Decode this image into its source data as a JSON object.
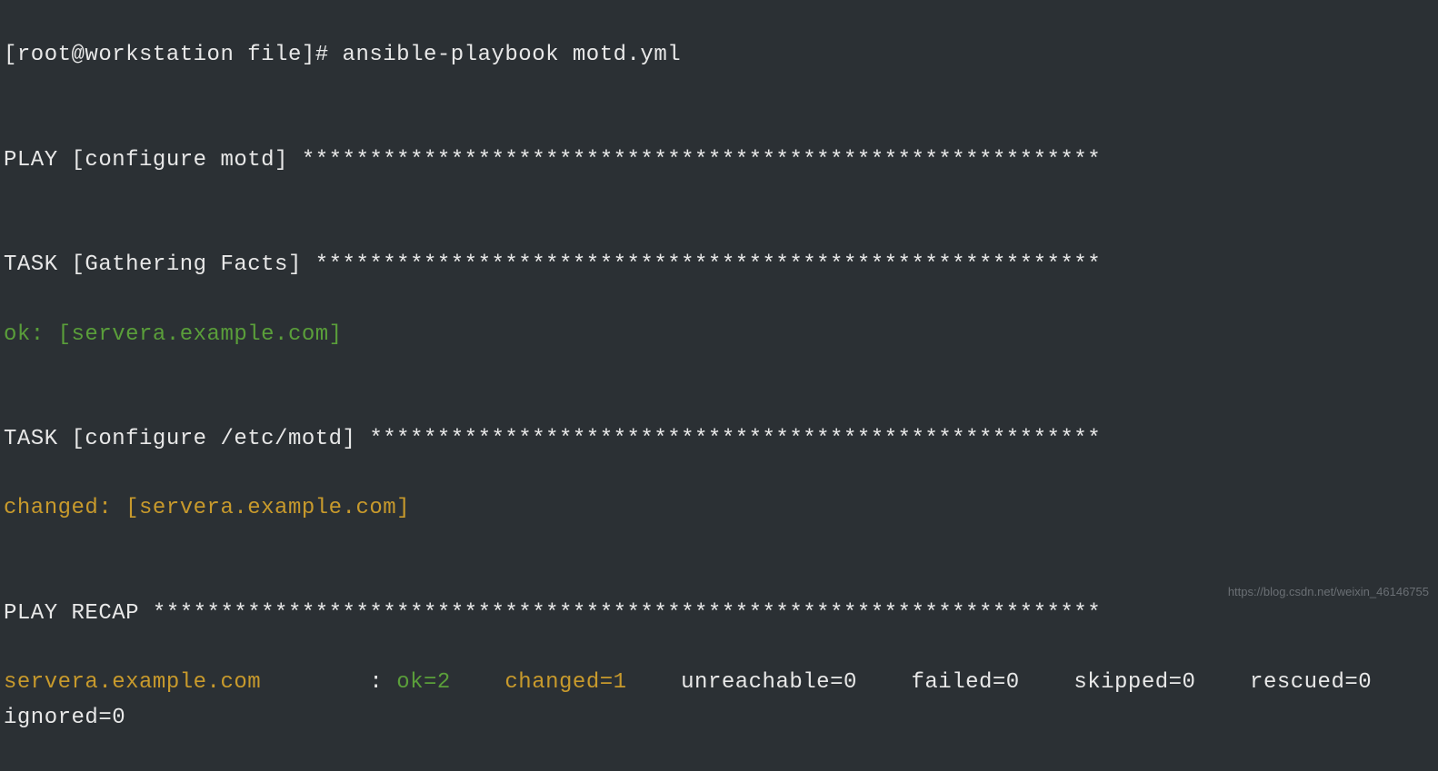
{
  "prompt": "[root@workstation file]# ansible-playbook motd.yml",
  "play_header": "PLAY [configure motd] ***********************************************************",
  "task1_header": "TASK [Gathering Facts] **********************************************************",
  "task1_result": "ok: [servera.example.com]",
  "task2_header": "TASK [configure /etc/motd] ******************************************************",
  "task2_result": "changed: [servera.example.com]",
  "recap_header": "PLAY RECAP **********************************************************************",
  "recap": {
    "host": "servera.example.com",
    "pad": "        : ",
    "ok": "ok=2",
    "changed": "changed=1",
    "unreachable": "unreachable=0",
    "failed": "failed=0",
    "skipped": "skipped=0",
    "rescued": "rescued=0",
    "ignored": "ignored=0"
  },
  "watermark": "https://blog.csdn.net/weixin_46146755"
}
